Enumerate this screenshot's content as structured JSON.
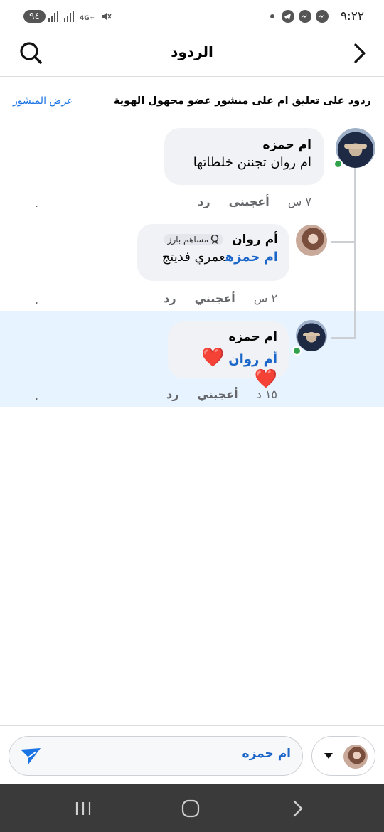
{
  "status_bar": {
    "time": "٩:٢٢",
    "battery": "٩٤",
    "network": "4G+",
    "app_icons": [
      "messenger-icon",
      "messenger-icon",
      "telegram-icon"
    ]
  },
  "header": {
    "title": "الردود"
  },
  "context": {
    "text": "ردود على تعليق ام على منشور عضو مجهول الهوية",
    "link": "عرض المنشور"
  },
  "comments": [
    {
      "author": "ام حمزه",
      "text": "ام روان تجننن خلطاتها",
      "time": "٧ س",
      "like_label": "أعجبني",
      "reply_label": "رد",
      "trailing": "."
    },
    {
      "author": "أم روان",
      "badge": "مساهم بارز",
      "mention": "ام حمزه",
      "text": "عمري فديتج",
      "time": "٢ س",
      "like_label": "أعجبني",
      "reply_label": "رد",
      "trailing": "."
    },
    {
      "author": "ام حمزه",
      "mention": "أم روان",
      "text": "❤️❤️",
      "time": "١٥ د",
      "like_label": "أعجبني",
      "reply_label": "رد",
      "trailing": "."
    }
  ],
  "composer": {
    "value": "ام حمزه"
  },
  "colors": {
    "accent": "#1b74e4",
    "mention": "#1b66c9",
    "online": "#31a24c",
    "highlight": "#e7f3ff"
  }
}
